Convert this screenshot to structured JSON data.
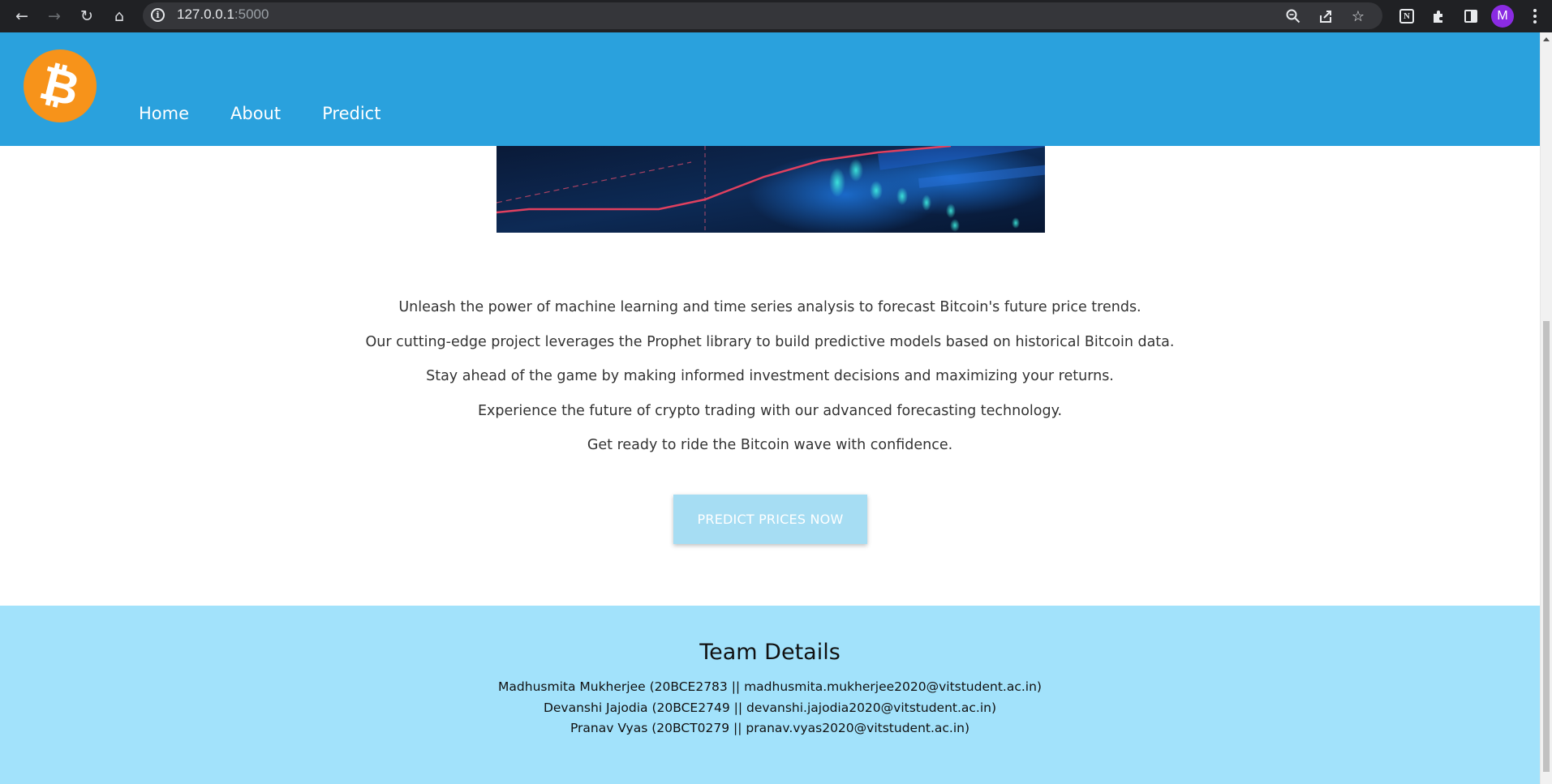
{
  "browser": {
    "url_host": "127.0.0.1",
    "url_port": ":5000",
    "profile_initial": "M",
    "icons": [
      "back-icon",
      "forward-icon",
      "reload-icon",
      "home-icon",
      "info-icon",
      "zoom-icon",
      "share-icon",
      "star-icon",
      "notion-icon",
      "extensions-icon",
      "side-panel-icon",
      "menu-icon"
    ]
  },
  "site": {
    "logo_glyph": "₿",
    "nav": [
      "Home",
      "About",
      "Predict"
    ],
    "description": [
      "Unleash the power of machine learning and time series analysis to forecast Bitcoin's future price trends.",
      "Our cutting-edge project leverages the Prophet library to build predictive models based on historical Bitcoin data.",
      "Stay ahead of the game by making informed investment decisions and maximizing your returns.",
      "Experience the future of crypto trading with our advanced forecasting technology.",
      "Get ready to ride the Bitcoin wave with confidence."
    ],
    "cta_label": "PREDICT PRICES NOW",
    "footer": {
      "title": "Team Details",
      "members": [
        "Madhusmita Mukherjee (20BCE2783 || madhusmita.mukherjee2020@vitstudent.ac.in)",
        "Devanshi Jajodia (20BCE2749 || devanshi.jajodia2020@vitstudent.ac.in)",
        "Pranav Vyas (20BCT0279 || pranav.vyas2020@vitstudent.ac.in)"
      ]
    }
  },
  "colors": {
    "header_bg": "#2aa1dd",
    "logo_bg": "#f7931a",
    "button_bg": "#a6ddf3",
    "footer_bg": "#a2e2fb"
  }
}
